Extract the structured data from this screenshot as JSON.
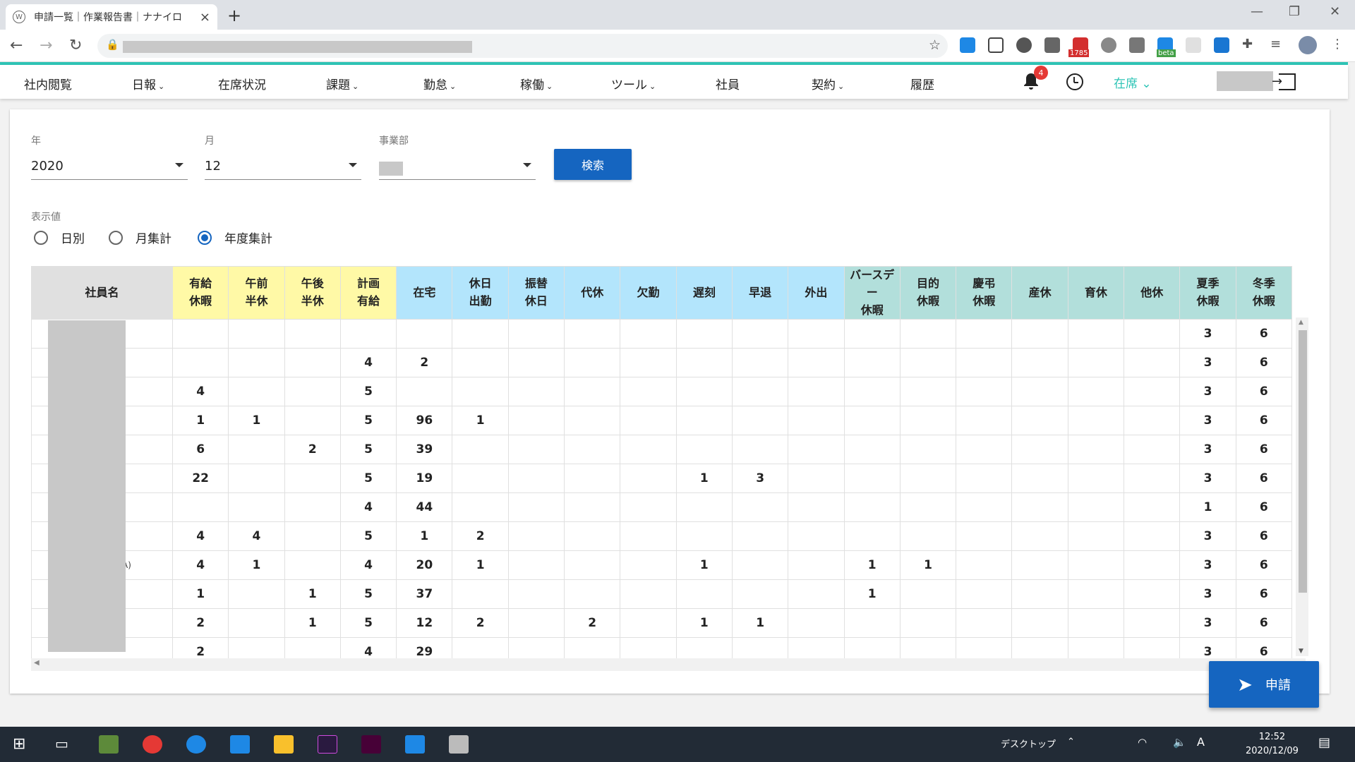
{
  "browser": {
    "tab_title": "申請一覧｜作業報告書｜ナナイロ",
    "ext_badge_mail": "1785",
    "ext_badge_beta": "beta"
  },
  "nav": {
    "items": [
      "社内閲覧",
      "日報",
      "在席状況",
      "課題",
      "勤怠",
      "稼働",
      "ツール",
      "社員",
      "契約",
      "履歴"
    ],
    "notification_count": "4",
    "status_label": "在席"
  },
  "filters": {
    "year_label": "年",
    "year_value": "2020",
    "month_label": "月",
    "month_value": "12",
    "dept_label": "事業部",
    "search_button": "検索"
  },
  "display": {
    "label": "表示値",
    "options": [
      "日別",
      "月集計",
      "年度集計"
    ],
    "selected": "年度集計"
  },
  "table": {
    "name_header": "社員名",
    "columns": [
      {
        "l1": "有給",
        "l2": "休暇",
        "color": "#fff9a6"
      },
      {
        "l1": "午前",
        "l2": "半休",
        "color": "#fff9a6"
      },
      {
        "l1": "午後",
        "l2": "半休",
        "color": "#fff9a6"
      },
      {
        "l1": "計画",
        "l2": "有給",
        "color": "#fff9a6"
      },
      {
        "l1": "在宅",
        "l2": "",
        "color": "#b3e5fc"
      },
      {
        "l1": "休日",
        "l2": "出勤",
        "color": "#b3e5fc"
      },
      {
        "l1": "振替",
        "l2": "休日",
        "color": "#b3e5fc"
      },
      {
        "l1": "代休",
        "l2": "",
        "color": "#b3e5fc"
      },
      {
        "l1": "欠勤",
        "l2": "",
        "color": "#b3e5fc"
      },
      {
        "l1": "遅刻",
        "l2": "",
        "color": "#b3e5fc"
      },
      {
        "l1": "早退",
        "l2": "",
        "color": "#b3e5fc"
      },
      {
        "l1": "外出",
        "l2": "",
        "color": "#b3e5fc"
      },
      {
        "l1": "バースデー",
        "l2": "休暇",
        "color": "#b2dfdb"
      },
      {
        "l1": "目的",
        "l2": "休暇",
        "color": "#b2dfdb"
      },
      {
        "l1": "慶弔",
        "l2": "休暇",
        "color": "#b2dfdb"
      },
      {
        "l1": "産休",
        "l2": "",
        "color": "#b2dfdb"
      },
      {
        "l1": "育休",
        "l2": "",
        "color": "#b2dfdb"
      },
      {
        "l1": "他休",
        "l2": "",
        "color": "#b2dfdb"
      },
      {
        "l1": "夏季",
        "l2": "休暇",
        "color": "#b2dfdb"
      },
      {
        "l1": "冬季",
        "l2": "休暇",
        "color": "#b2dfdb"
      }
    ],
    "rows": [
      {
        "name": "",
        "values": [
          "",
          "",
          "",
          "",
          "",
          "",
          "",
          "",
          "",
          "",
          "",
          "",
          "",
          "",
          "",
          "",
          "",
          "",
          "3",
          "6"
        ]
      },
      {
        "name": "",
        "values": [
          "",
          "",
          "",
          "4",
          "2",
          "",
          "",
          "",
          "",
          "",
          "",
          "",
          "",
          "",
          "",
          "",
          "",
          "",
          "3",
          "6"
        ]
      },
      {
        "name": "",
        "values": [
          "4",
          "",
          "",
          "5",
          "",
          "",
          "",
          "",
          "",
          "",
          "",
          "",
          "",
          "",
          "",
          "",
          "",
          "",
          "3",
          "6"
        ]
      },
      {
        "name": "",
        "values": [
          "1",
          "1",
          "",
          "5",
          "96",
          "1",
          "",
          "",
          "",
          "",
          "",
          "",
          "",
          "",
          "",
          "",
          "",
          "",
          "3",
          "6"
        ]
      },
      {
        "name": "",
        "values": [
          "6",
          "",
          "2",
          "5",
          "39",
          "",
          "",
          "",
          "",
          "",
          "",
          "",
          "",
          "",
          "",
          "",
          "",
          "",
          "3",
          "6"
        ]
      },
      {
        "name": "",
        "values": [
          "22",
          "",
          "",
          "5",
          "19",
          "",
          "",
          "",
          "",
          "1",
          "3",
          "",
          "",
          "",
          "",
          "",
          "",
          "",
          "3",
          "6"
        ]
      },
      {
        "name": "",
        "values": [
          "",
          "",
          "",
          "4",
          "44",
          "",
          "",
          "",
          "",
          "",
          "",
          "",
          "",
          "",
          "",
          "",
          "",
          "",
          "1",
          "6"
        ]
      },
      {
        "name": "",
        "values": [
          "4",
          "4",
          "",
          "5",
          "1",
          "2",
          "",
          "",
          "",
          "",
          "",
          "",
          "",
          "",
          "",
          "",
          "",
          "",
          "3",
          "6"
        ]
      },
      {
        "name": "A)",
        "values": [
          "4",
          "1",
          "",
          "4",
          "20",
          "1",
          "",
          "",
          "",
          "1",
          "",
          "",
          "1",
          "1",
          "",
          "",
          "",
          "",
          "3",
          "6"
        ]
      },
      {
        "name": "",
        "values": [
          "1",
          "",
          "1",
          "5",
          "37",
          "",
          "",
          "",
          "",
          "",
          "",
          "",
          "1",
          "",
          "",
          "",
          "",
          "",
          "3",
          "6"
        ]
      },
      {
        "name": "",
        "values": [
          "2",
          "",
          "1",
          "5",
          "12",
          "2",
          "",
          "2",
          "",
          "1",
          "1",
          "",
          "",
          "",
          "",
          "",
          "",
          "",
          "3",
          "6"
        ]
      },
      {
        "name": "",
        "values": [
          "2",
          "",
          "",
          "4",
          "29",
          "",
          "",
          "",
          "",
          "",
          "",
          "",
          "",
          "",
          "",
          "",
          "",
          "",
          "3",
          "6"
        ]
      }
    ]
  },
  "apply_button": "申請",
  "taskbar": {
    "desktop_label": "デスクトップ",
    "time": "12:52",
    "date": "2020/12/09"
  }
}
